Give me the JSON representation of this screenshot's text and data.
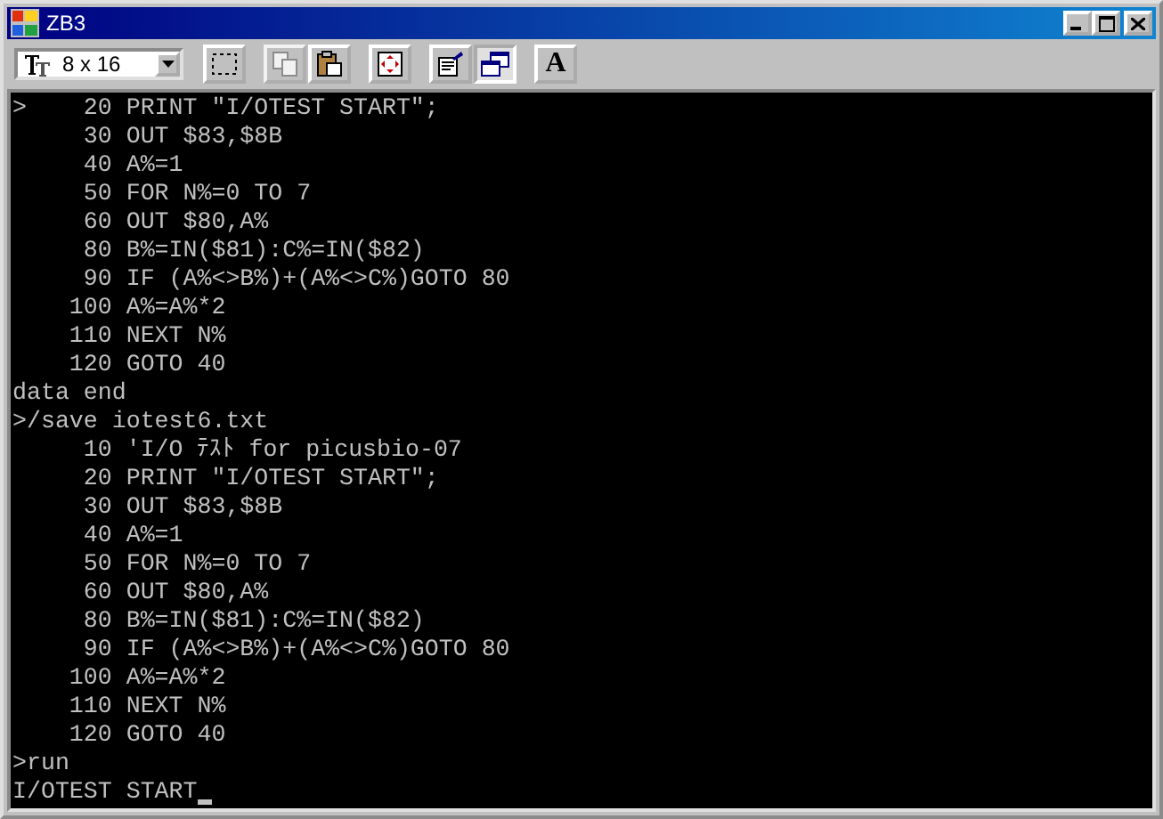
{
  "window": {
    "title": "ZB3"
  },
  "toolbar": {
    "font_size": "8 x 16",
    "tools": [
      {
        "kind": "mark",
        "disabled": false,
        "pressed": false
      },
      {
        "kind": "copy",
        "disabled": true,
        "pressed": false
      },
      {
        "kind": "paste",
        "disabled": false,
        "pressed": false
      },
      {
        "kind": "fullscreen",
        "disabled": false,
        "pressed": false
      },
      {
        "kind": "properties",
        "disabled": false,
        "pressed": false
      },
      {
        "kind": "background",
        "disabled": false,
        "pressed": true
      },
      {
        "kind": "font",
        "label": "A",
        "disabled": false,
        "pressed": false
      }
    ]
  },
  "terminal": {
    "cursor_shown": true,
    "lines": [
      ">    20 PRINT \"I/OTEST START\";",
      "     30 OUT $83,$8B",
      "     40 A%=1",
      "     50 FOR N%=0 TO 7",
      "     60 OUT $80,A%",
      "     80 B%=IN($81):C%=IN($82)",
      "     90 IF (A%<>B%)+(A%<>C%)GOTO 80",
      "    100 A%=A%*2",
      "    110 NEXT N%",
      "    120 GOTO 40",
      "data end",
      ">/save iotest6.txt",
      "     10 'I/O ﾃｽﾄ for picusbio-07",
      "     20 PRINT \"I/OTEST START\";",
      "     30 OUT $83,$8B",
      "     40 A%=1",
      "     50 FOR N%=0 TO 7",
      "     60 OUT $80,A%",
      "     80 B%=IN($81):C%=IN($82)",
      "     90 IF (A%<>B%)+(A%<>C%)GOTO 80",
      "    100 A%=A%*2",
      "    110 NEXT N%",
      "    120 GOTO 40",
      ">run",
      "I/OTEST START"
    ]
  }
}
